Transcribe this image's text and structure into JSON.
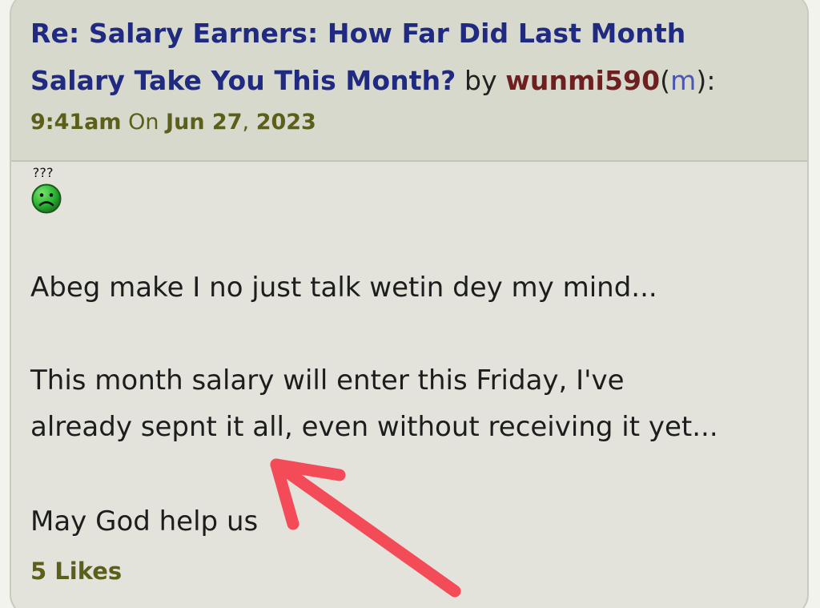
{
  "post": {
    "title_line_1": "Re: Salary Earners: How Far Did Last Month",
    "title_line_2": "Salary Take You This Month?",
    "by": " by ",
    "author": "wunmi590",
    "author_badge_open": "(",
    "author_badge": "m",
    "author_badge_close": "):",
    "time": "9:41am",
    "on": " On ",
    "date_main": "Jun 27",
    "date_sep": ", ",
    "year": "2023",
    "emoji_marks": "???",
    "emoji_icon": "sad-smiley-icon",
    "paragraphs": [
      "Abeg make I no just talk wetin dey my mind...",
      "This month salary will enter this Friday, I've",
      "already sepnt it all, even without receiving it yet...",
      "May God help us"
    ],
    "likes": "5 Likes"
  },
  "annotation": {
    "icon": "red-arrow-icon",
    "color": "#f34b58"
  },
  "colors": {
    "title": "#1f2a80",
    "author": "#6e1f1f",
    "meta": "#5b5f19",
    "header_bg": "#d7d9cd",
    "body_bg": "#e3e3dc"
  }
}
